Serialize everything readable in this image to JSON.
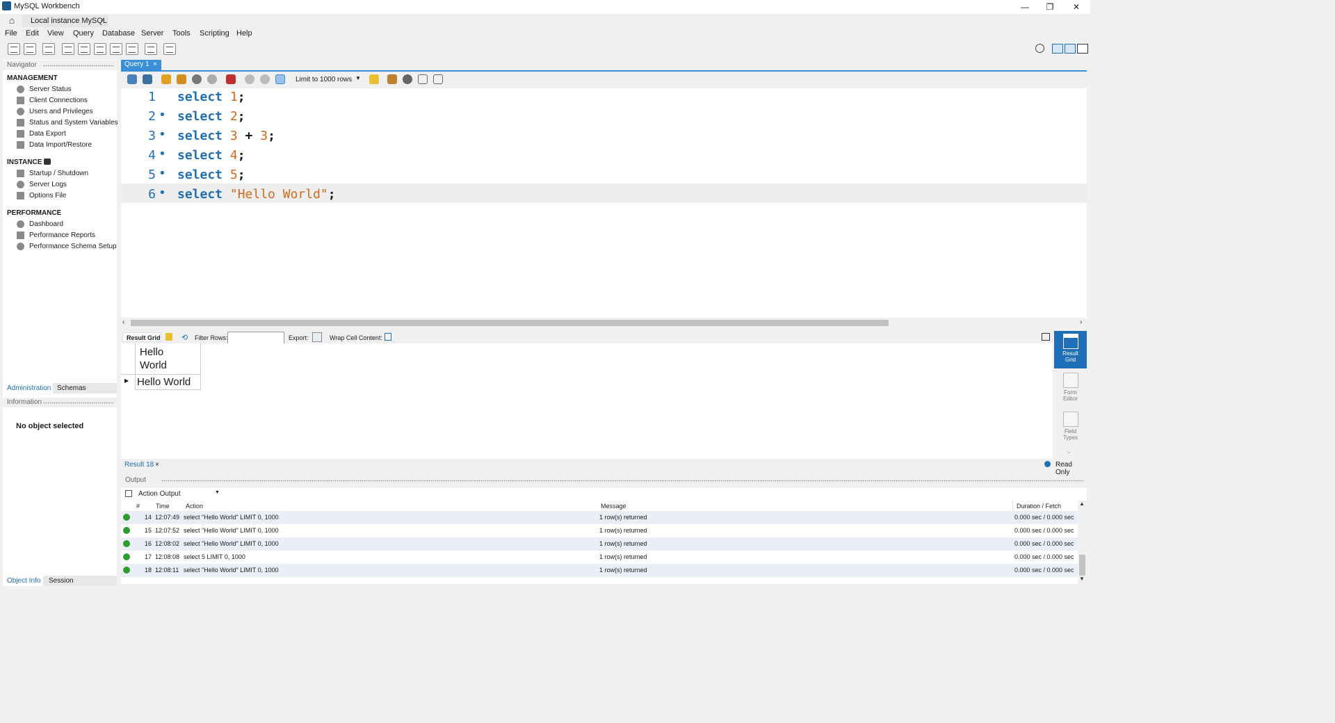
{
  "window": {
    "title": "MySQL Workbench",
    "minimize": "—",
    "restore": "❐",
    "close": "✕"
  },
  "tabs": {
    "home_icon": "home-icon",
    "connection": "Local instance MySQL",
    "close_glyph": "×"
  },
  "menu": [
    "File",
    "Edit",
    "View",
    "Query",
    "Database",
    "Server",
    "Tools",
    "Scripting",
    "Help"
  ],
  "navigator": {
    "header": "Navigator",
    "management": {
      "title": "MANAGEMENT",
      "items": [
        "Server Status",
        "Client Connections",
        "Users and Privileges",
        "Status and System Variables",
        "Data Export",
        "Data Import/Restore"
      ]
    },
    "instance": {
      "title": "INSTANCE",
      "items": [
        "Startup / Shutdown",
        "Server Logs",
        "Options File"
      ]
    },
    "performance": {
      "title": "PERFORMANCE",
      "items": [
        "Dashboard",
        "Performance Reports",
        "Performance Schema Setup"
      ]
    },
    "bottom_tabs": [
      "Administration",
      "Schemas"
    ],
    "information_header": "Information",
    "no_object": "No object selected",
    "footer_tabs": [
      "Object Info",
      "Session"
    ]
  },
  "editor": {
    "tab_label": "Query 1",
    "limit_label": "Limit to 1000 rows",
    "lines": [
      {
        "n": "1",
        "dot": "",
        "kw": "select",
        "rest": [
          {
            "t": " "
          },
          {
            "t": "1",
            "c": "num"
          },
          {
            "t": ";",
            "c": "pun"
          }
        ]
      },
      {
        "n": "2",
        "dot": "•",
        "kw": "select",
        "rest": [
          {
            "t": " "
          },
          {
            "t": "2",
            "c": "num"
          },
          {
            "t": ";",
            "c": "pun"
          }
        ]
      },
      {
        "n": "3",
        "dot": "•",
        "kw": "select",
        "rest": [
          {
            "t": " "
          },
          {
            "t": "3",
            "c": "num"
          },
          {
            "t": " + ",
            "c": "pun"
          },
          {
            "t": "3",
            "c": "num"
          },
          {
            "t": ";",
            "c": "pun"
          }
        ]
      },
      {
        "n": "4",
        "dot": "•",
        "kw": "select",
        "rest": [
          {
            "t": " "
          },
          {
            "t": "4",
            "c": "num"
          },
          {
            "t": ";",
            "c": "pun"
          }
        ]
      },
      {
        "n": "5",
        "dot": "•",
        "kw": "select",
        "rest": [
          {
            "t": " "
          },
          {
            "t": "5",
            "c": "num"
          },
          {
            "t": ";",
            "c": "pun"
          }
        ]
      },
      {
        "n": "6",
        "dot": "•",
        "kw": "select",
        "rest": [
          {
            "t": " "
          },
          {
            "t": "\"Hello World\"",
            "c": "str"
          },
          {
            "t": ";",
            "c": "pun"
          }
        ]
      }
    ]
  },
  "results": {
    "grid_label": "Result Grid",
    "filter_label": "Filter Rows:",
    "filter_value": "",
    "export_label": "Export:",
    "wrap_label": "Wrap Cell Content:",
    "column_header_line1": "Hello",
    "column_header_line2": "World",
    "cell_value": "Hello World",
    "tab_label": "Result 18",
    "read_only": "Read Only",
    "side_buttons": [
      {
        "line1": "Result",
        "line2": "Grid"
      },
      {
        "line1": "Form",
        "line2": "Editor"
      },
      {
        "line1": "Field",
        "line2": "Types"
      }
    ]
  },
  "output": {
    "header": "Output",
    "selector": "Action Output",
    "columns": [
      "#",
      "Time",
      "Action",
      "Message",
      "Duration / Fetch"
    ],
    "rows": [
      {
        "n": "14",
        "time": "12:07:49",
        "action": "select \"Hello World\" LIMIT 0, 1000",
        "message": "1 row(s) returned",
        "duration": "0.000 sec / 0.000 sec"
      },
      {
        "n": "15",
        "time": "12:07:52",
        "action": "select \"Hello World\" LIMIT 0, 1000",
        "message": "1 row(s) returned",
        "duration": "0.000 sec / 0.000 sec"
      },
      {
        "n": "16",
        "time": "12:08:02",
        "action": "select \"Hello World\" LIMIT 0, 1000",
        "message": "1 row(s) returned",
        "duration": "0.000 sec / 0.000 sec"
      },
      {
        "n": "17",
        "time": "12:08:08",
        "action": "select 5 LIMIT 0, 1000",
        "message": "1 row(s) returned",
        "duration": "0.000 sec / 0.000 sec"
      },
      {
        "n": "18",
        "time": "12:08:11",
        "action": "select \"Hello World\" LIMIT 0, 1000",
        "message": "1 row(s) returned",
        "duration": "0.000 sec / 0.000 sec"
      }
    ]
  },
  "colors": {
    "accent": "#3b8ed8",
    "keyword": "#1e6fb5",
    "literal": "#d2691e",
    "success": "#2a9d2a"
  }
}
